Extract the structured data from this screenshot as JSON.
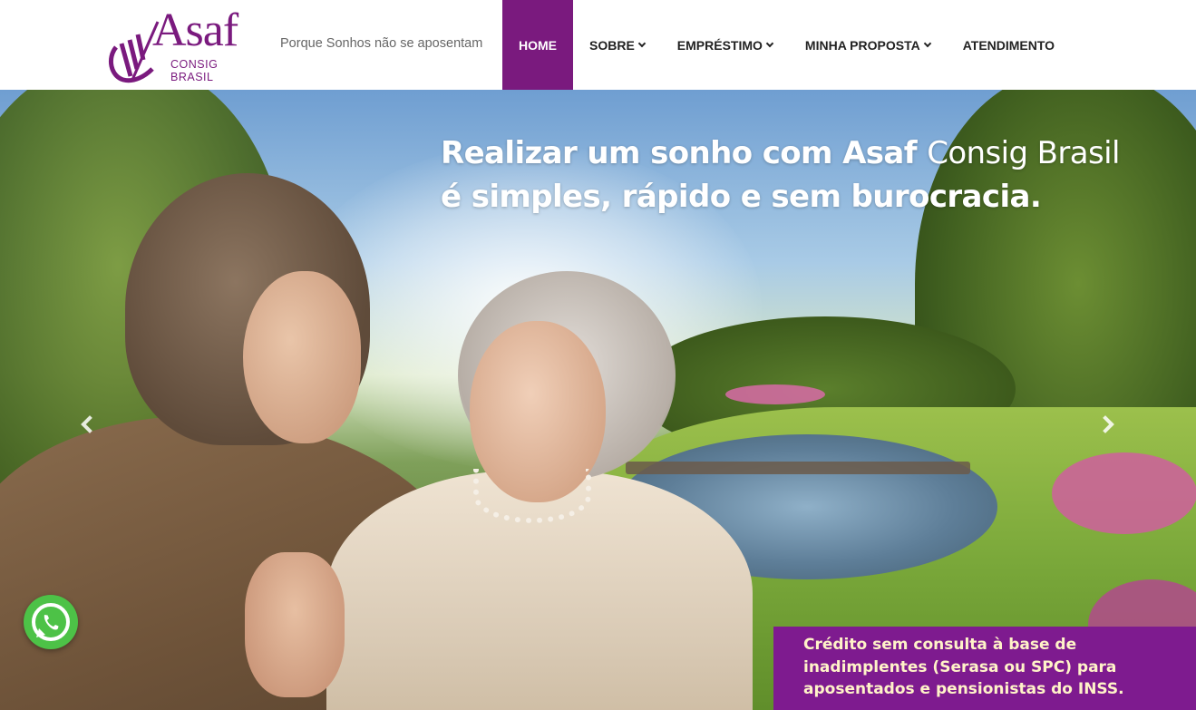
{
  "brand": {
    "name": "Asaf",
    "subtitle": "CONSIG BRASIL",
    "tagline": "Porque Sonhos não se aposentam",
    "accent_color": "#7a1a7e"
  },
  "nav": {
    "items": [
      {
        "label": "HOME",
        "active": true,
        "has_dropdown": false
      },
      {
        "label": "SOBRE",
        "active": false,
        "has_dropdown": true
      },
      {
        "label": "EMPRÉSTIMO",
        "active": false,
        "has_dropdown": true
      },
      {
        "label": "MINHA PROPOSTA",
        "active": false,
        "has_dropdown": true
      },
      {
        "label": "ATENDIMENTO",
        "active": false,
        "has_dropdown": false
      }
    ],
    "dropdown_icon": "chevron-down-icon"
  },
  "hero": {
    "headline_bold_1": "Realizar um sonho com Asaf",
    "headline_light": "Consig Brasil",
    "headline_line_2": "é simples, rápido e sem burocracia.",
    "promo_lines": [
      "Crédito sem consulta à base de",
      "inadimplentes (Serasa ou SPC) para",
      "aposentados e pensionistas do INSS."
    ],
    "promo_background": "#7e1b8f",
    "prev_icon": "chevron-left-icon",
    "next_icon": "chevron-right-icon"
  },
  "whatsapp": {
    "icon": "whatsapp-icon",
    "color": "#4dc247"
  }
}
